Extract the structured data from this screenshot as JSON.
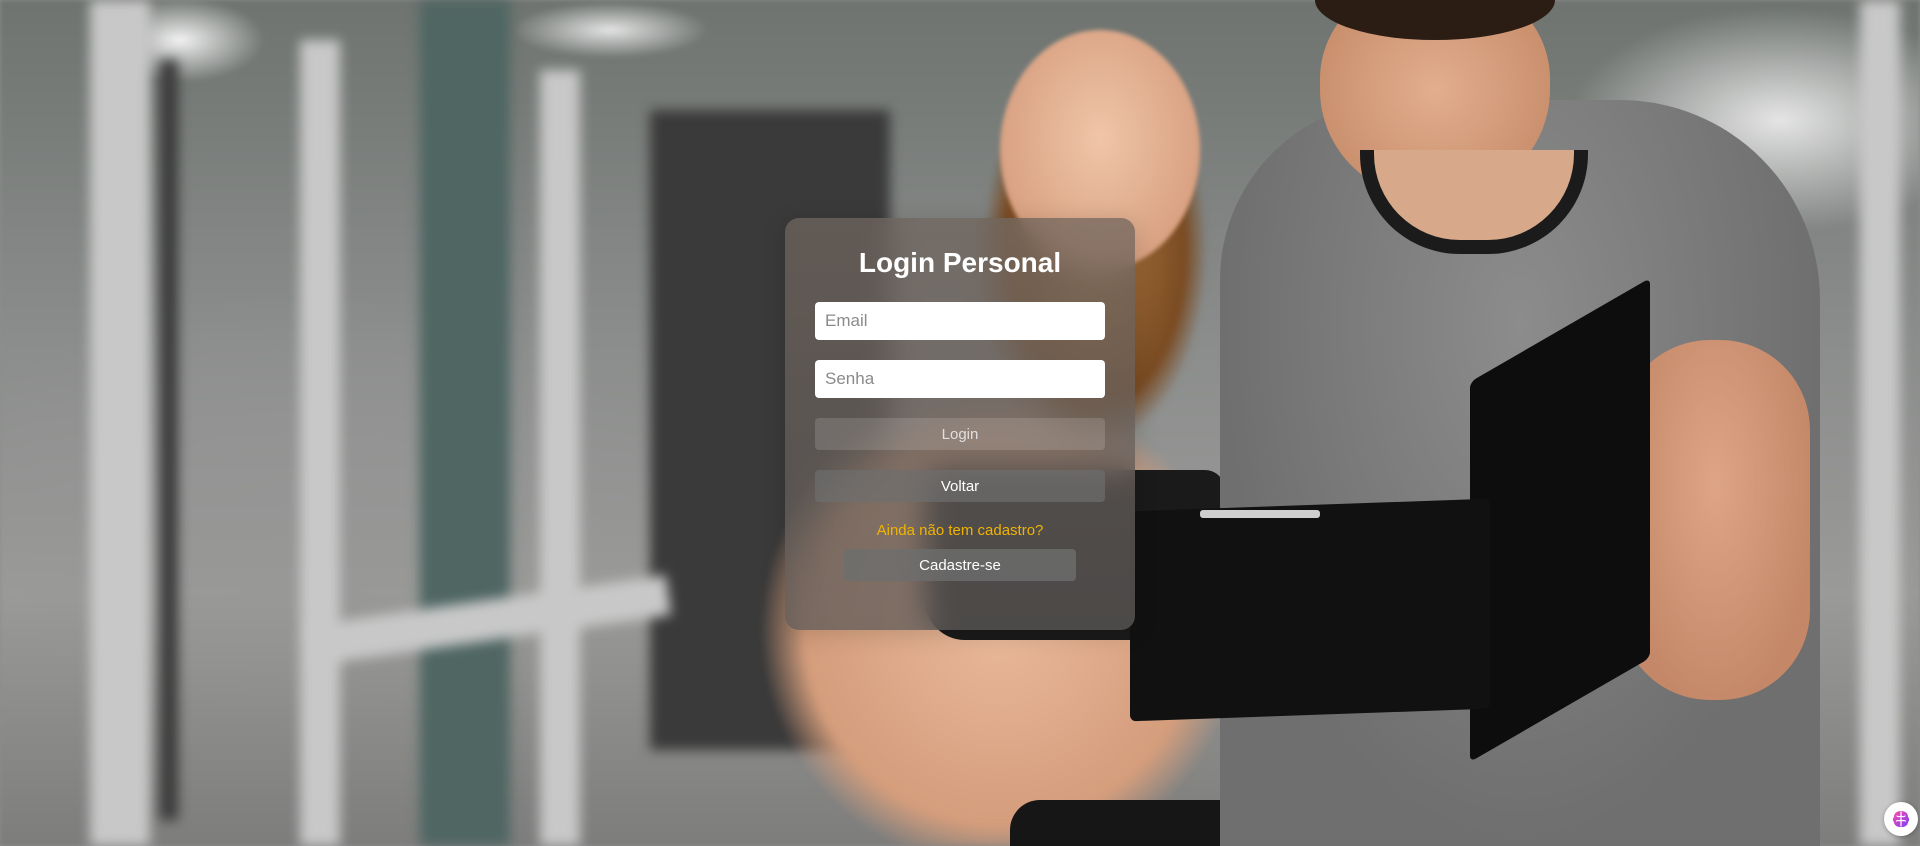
{
  "login": {
    "title": "Login Personal",
    "email_placeholder": "Email",
    "password_placeholder": "Senha",
    "login_label": "Login",
    "back_label": "Voltar",
    "signup_prompt": "Ainda não tem cadastro?",
    "signup_label": "Cadastre-se"
  },
  "colors": {
    "title_text": "#ffffff",
    "signup_prompt_text": "#f0b400",
    "input_background": "#ffffff"
  },
  "background": {
    "subject": "gym photo with personal trainer and client"
  },
  "extension_badge": {
    "icon": "brain-icon"
  }
}
